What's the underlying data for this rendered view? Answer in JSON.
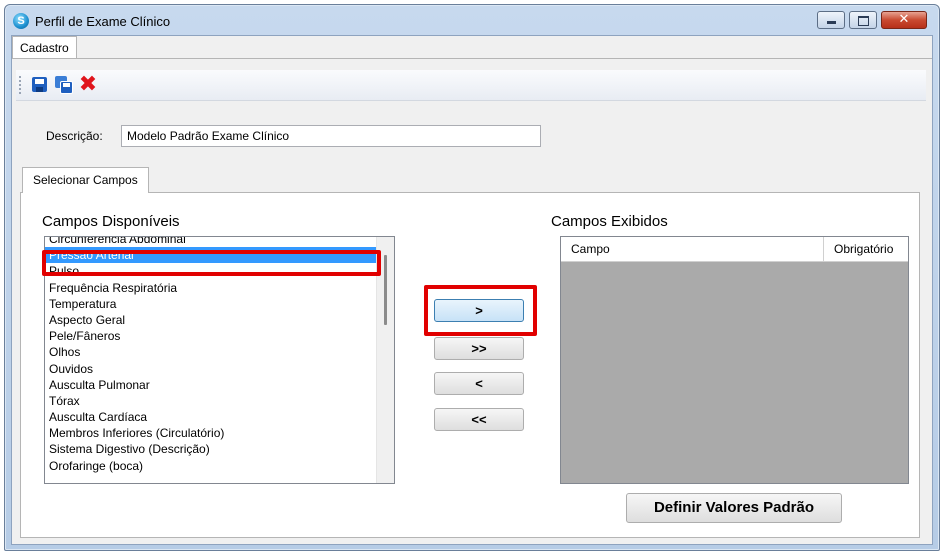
{
  "window": {
    "title": "Perfil de Exame Clínico",
    "app_icon": "S"
  },
  "menu_tab": {
    "label": "Cadastro"
  },
  "toolbar": {
    "buttons": [
      {
        "name": "save",
        "icon": "floppy-disk-icon"
      },
      {
        "name": "save-all",
        "icon": "save-multiple-icon"
      },
      {
        "name": "delete",
        "icon": "red-x-icon",
        "glyph": "✖"
      }
    ]
  },
  "form": {
    "description_label": "Descrição:",
    "description_value": "Modelo Padrão Exame Clínico"
  },
  "inner_tab": {
    "label": "Selecionar Campos"
  },
  "available": {
    "title": "Campos Disponíveis",
    "items": [
      "Circunferência Abdominal",
      "Pressão Arterial",
      "Pulso",
      "Frequência Respiratória",
      "Temperatura",
      "Aspecto Geral",
      "Pele/Fâneros",
      "Olhos",
      "Ouvidos",
      "Ausculta Pulmonar",
      "Tórax",
      "Ausculta Cardíaca",
      "Membros Inferiores (Circulatório)",
      "Sistema Digestivo (Descrição)",
      "Orofaringe (boca)"
    ],
    "selected_index": 1
  },
  "transfer_buttons": {
    "add_one": ">",
    "add_all": ">>",
    "remove_one": "<",
    "remove_all": "<<"
  },
  "shown": {
    "title": "Campos Exibidos",
    "columns": [
      "Campo",
      "Obrigatório"
    ],
    "rows": []
  },
  "actions": {
    "default_values": "Definir Valores Padrão"
  },
  "colors": {
    "selection": "#3399ff",
    "highlight": "#e10000",
    "grid_background": "#aaaaaa"
  }
}
